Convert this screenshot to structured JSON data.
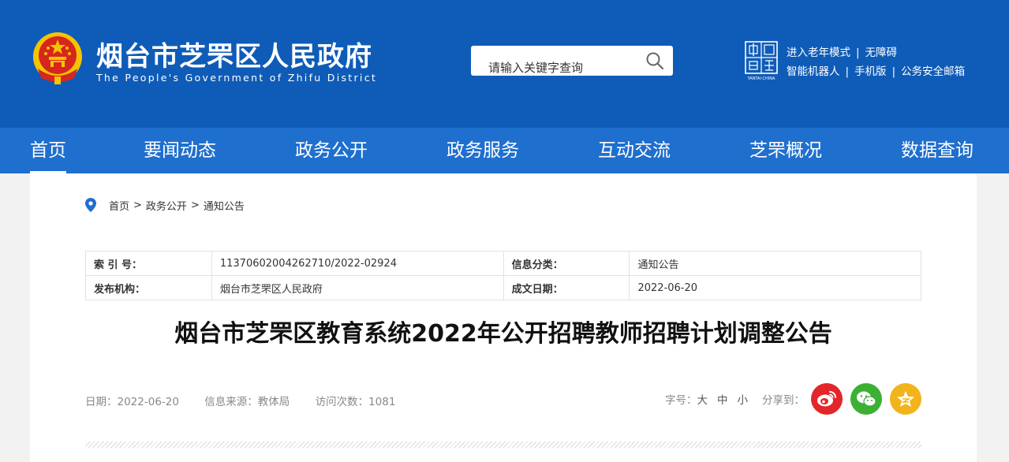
{
  "header": {
    "title": "烟台市芝罘区人民政府",
    "subtitle": "The People's Government of Zhifu District",
    "search_placeholder": "请输入关键字查询",
    "links_row1": [
      "进入老年模式",
      "无障碍"
    ],
    "links_row2": [
      "智能机器人",
      "手机版",
      "公务安全邮箱"
    ],
    "cn_logo_caption": "YANTAI·CHINA"
  },
  "nav": {
    "items": [
      "首页",
      "要闻动态",
      "政务公开",
      "政务服务",
      "互动交流",
      "芝罘概况",
      "数据查询"
    ],
    "active": "首页"
  },
  "breadcrumb": [
    "首页",
    "政务公开",
    "通知公告"
  ],
  "meta": {
    "index_label": "索 引 号：",
    "index_value": "11370602004262710/2022-02924",
    "category_label": "信息分类：",
    "category_value": "通知公告",
    "publisher_label": "发布机构：",
    "publisher_value": "烟台市芝罘区人民政府",
    "date_label": "成文日期：",
    "date_value": "2022-06-20"
  },
  "article": {
    "title": "烟台市芝罘区教育系统2022年公开招聘教师招聘计划调整公告",
    "date": "日期：2022-06-20",
    "source": "信息来源：教体局",
    "visits": "访问次数：1081"
  },
  "tools": {
    "font_label": "字号：",
    "font_large": "大",
    "font_medium": "中",
    "font_small": "小",
    "share_label": "分享到：",
    "share_icons": [
      "weibo-icon",
      "wechat-icon",
      "qzone-icon"
    ]
  },
  "colors": {
    "header_bg": "#0f5cb8",
    "nav_bg": "#1f6fce",
    "weibo": "#e2262a",
    "wechat": "#3cb034",
    "qzone": "#f2b41c"
  }
}
